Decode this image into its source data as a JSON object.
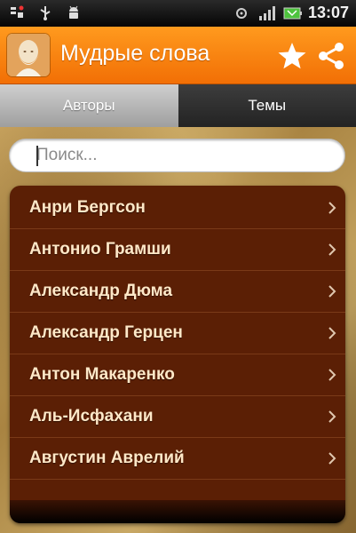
{
  "status_bar": {
    "time": "13:07",
    "icons": [
      "notification-icon",
      "usb-icon",
      "android-debug-icon",
      "sync-icon",
      "signal-icon",
      "battery-icon"
    ]
  },
  "action_bar": {
    "title": "Мудрые слова",
    "app_icon": "sage-portrait-icon",
    "actions": [
      "star-icon",
      "share-icon"
    ],
    "color": "#f5800f"
  },
  "tabs": [
    {
      "label": "Авторы",
      "active": true
    },
    {
      "label": "Темы",
      "active": false
    }
  ],
  "search": {
    "placeholder": "Поиск...",
    "value": ""
  },
  "authors": [
    "Анри Бергсон",
    "Антонио Грамши",
    "Александр Дюма",
    "Александр Герцен",
    "Антон Макаренко",
    "Аль-Исфахани",
    "Августин Аврелий"
  ],
  "colors": {
    "list_background": "#5b1f05",
    "list_text": "#ffe8c8"
  }
}
